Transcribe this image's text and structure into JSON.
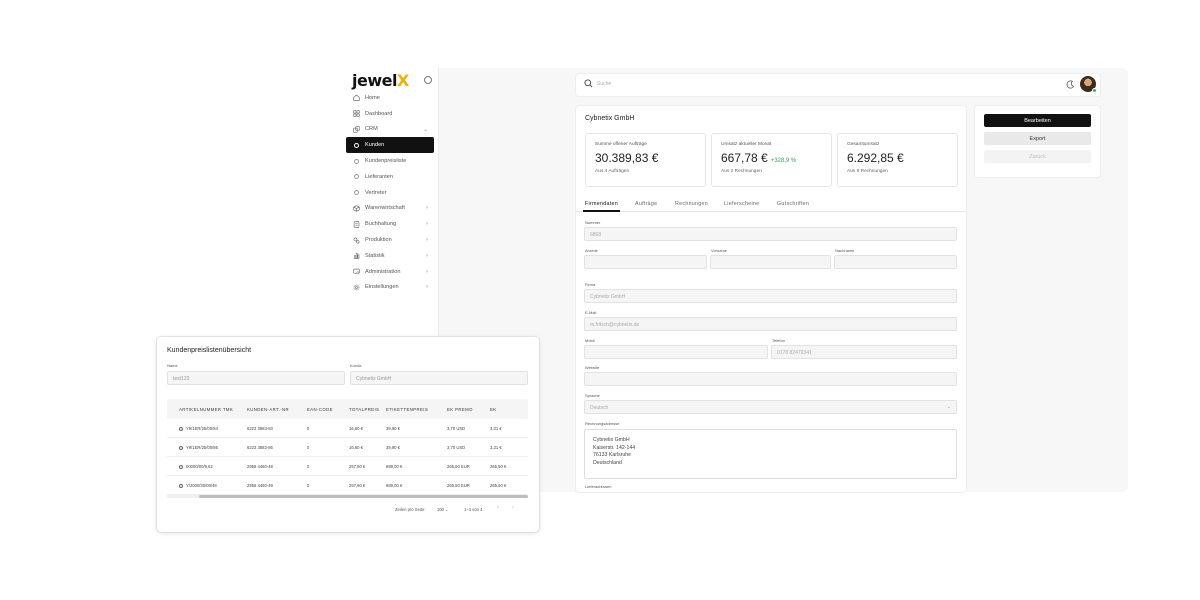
{
  "app": {
    "logo_main": "jewel",
    "logo_accent": "X"
  },
  "sidebar": {
    "items": [
      {
        "label": "Home",
        "icon": "home-icon"
      },
      {
        "label": "Dashboard",
        "icon": "dashboard-icon"
      },
      {
        "label": "CRM",
        "icon": "crm-icon",
        "chevron": "⌄"
      },
      {
        "label": "Kunden",
        "active": true
      },
      {
        "label": "Kundenpreisliste"
      },
      {
        "label": "Lieferanten"
      },
      {
        "label": "Vertreter"
      },
      {
        "label": "Warenwirtschaft",
        "icon": "box-icon",
        "chevron": "›"
      },
      {
        "label": "Buchhaltung",
        "icon": "ledger-icon",
        "chevron": "›"
      },
      {
        "label": "Produktion",
        "icon": "production-icon",
        "chevron": "›"
      },
      {
        "label": "Statistik",
        "icon": "chart-icon",
        "chevron": "›"
      },
      {
        "label": "Administration",
        "icon": "admin-icon",
        "chevron": "›"
      },
      {
        "label": "Einstellungen",
        "icon": "gear-icon",
        "chevron": "›"
      }
    ]
  },
  "search": {
    "placeholder": "Suche"
  },
  "customer": {
    "title": "Cybnetix GmbH",
    "stats": [
      {
        "label": "Summe offener Aufträge",
        "value": "30.389,83 €",
        "sub": "Aus 4 Aufträgen",
        "delta": ""
      },
      {
        "label": "Umsatz aktueller Monat",
        "value": "667,78 €",
        "sub": "Aus 2 Rechnungen",
        "delta": "+328,9 %"
      },
      {
        "label": "Gesamtumsatz",
        "value": "6.292,85 €",
        "sub": "Aus 9 Rechnungen",
        "delta": ""
      }
    ],
    "tabs": [
      "Firmendaten",
      "Aufträge",
      "Rechnungen",
      "Lieferscheine",
      "Gutschriften"
    ],
    "fields": {
      "nummer_label": "Nummer",
      "nummer_value": "6868",
      "anrede_label": "Anrede",
      "vorname_label": "Vorname",
      "nachname_label": "Nachname",
      "firma_label": "Firma",
      "firma_value": "Cybnetix GmbH",
      "email_label": "E-Mail",
      "email_value": "m.fritsch@cybnetix.de",
      "mobil_label": "Mobil",
      "telefon_label": "Telefon",
      "telefon_value": "0178 82479341",
      "website_label": "Website",
      "sprache_label": "Sprache",
      "sprache_value": "Deutsch",
      "rechnungsadresse_label": "Rechnungsadresse",
      "address_lines": [
        "Cybnetix GmbH",
        "Kaiserstr. 142-144",
        "76133 Karlsruhe",
        "Deutschland"
      ],
      "lieferadressen_label": "Lieferadressen"
    }
  },
  "actions": {
    "edit": "Bearbeiten",
    "export": "Export",
    "back": "Zurück"
  },
  "overlay": {
    "title": "Kundenpreislistenübersicht",
    "name_label": "Name",
    "name_value": "test123",
    "kunde_label": "Kunde",
    "kunde_value": "Cybnetix GmbH",
    "columns": [
      "ARTIKELNUMMER TMK",
      "KUNDEN-ART.-NR",
      "EAN-CODE",
      "TOTALPREIS",
      "ETIKETTENPREIS",
      "EK PREMO",
      "EK"
    ],
    "rows": [
      [
        "Y9/1ER/25/00/84",
        "6223 3883-84",
        "0",
        "16,60 €",
        "39,90 €",
        "3,70 USD",
        "3,31 €"
      ],
      [
        "Y9/1ER/25/00/86",
        "6223 3883-86",
        "0",
        "16,60 €",
        "39,90 €",
        "3,70 USD",
        "3,31 €"
      ],
      [
        "00000/00/9,62",
        "2956 4460-48",
        "0",
        "257,60 €",
        "689,00 €",
        "265,50 EUR",
        "265,50 €"
      ],
      [
        "Y/2000/30/00/48",
        "2956 4460-49",
        "0",
        "257,60 €",
        "689,00 €",
        "265,50 EUR",
        "265,50 €"
      ]
    ],
    "rows_per_page_label": "Zeilen pro Seite:",
    "rows_per_page": "100",
    "range": "1–4 von 4",
    "prev": "‹",
    "next": "›"
  }
}
